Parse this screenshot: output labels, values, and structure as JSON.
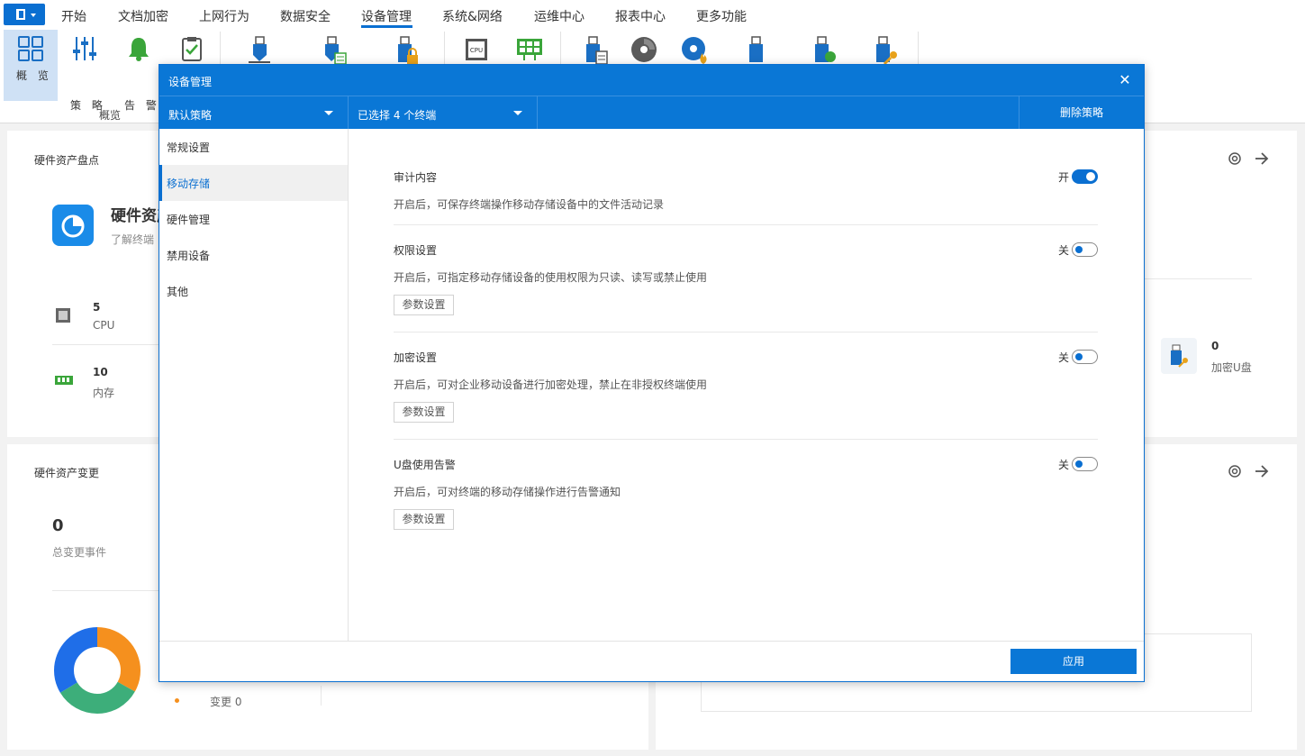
{
  "menubar": {
    "items": [
      "开始",
      "文档加密",
      "上网行为",
      "数据安全",
      "设备管理",
      "系统&网络",
      "运维中心",
      "报表中心",
      "更多功能"
    ],
    "active": "设备管理"
  },
  "ribbon": {
    "overview_label": "概 览",
    "policy_label": "策 略",
    "alarm_label": "告 警",
    "group_label": "概览"
  },
  "bg": {
    "hw_inventory": {
      "title": "硬件资产盘点",
      "heading": "硬件资产",
      "subtitle": "了解终端",
      "cpu_count": "5",
      "cpu_label": "CPU",
      "mem_count": "10",
      "mem_label": "内存",
      "enc_usb_count": "0",
      "enc_usb_label": "加密U盘"
    },
    "hw_change": {
      "title": "硬件资产变更",
      "total": "0",
      "total_label": "总变更事件",
      "legend_change": "变更 0"
    }
  },
  "modal": {
    "title": "设备管理",
    "policy_select": "默认策略",
    "terminal_select": "已选择 4 个终端",
    "delete_policy": "删除策略",
    "sidebar": [
      "常规设置",
      "移动存储",
      "硬件管理",
      "禁用设备",
      "其他"
    ],
    "active_sidebar": "移动存储",
    "sections": [
      {
        "title": "审计内容",
        "desc": "开启后，可保存终端操作移动存储设备中的文件活动记录",
        "state_label": "开",
        "enabled": true
      },
      {
        "title": "权限设置",
        "desc": "开启后，可指定移动存储设备的使用权限为只读、读写或禁止使用",
        "state_label": "关",
        "enabled": false,
        "button": "参数设置"
      },
      {
        "title": "加密设置",
        "desc": "开启后，可对企业移动设备进行加密处理，禁止在非授权终端使用",
        "state_label": "关",
        "enabled": false,
        "button": "参数设置"
      },
      {
        "title": "U盘使用告警",
        "desc": "开启后，可对终端的移动存储操作进行告警通知",
        "state_label": "关",
        "enabled": false,
        "button": "参数设置"
      }
    ],
    "apply": "应用"
  },
  "colors": {
    "accent": "#0a77d6",
    "selected_bg": "#cfe1f5"
  }
}
